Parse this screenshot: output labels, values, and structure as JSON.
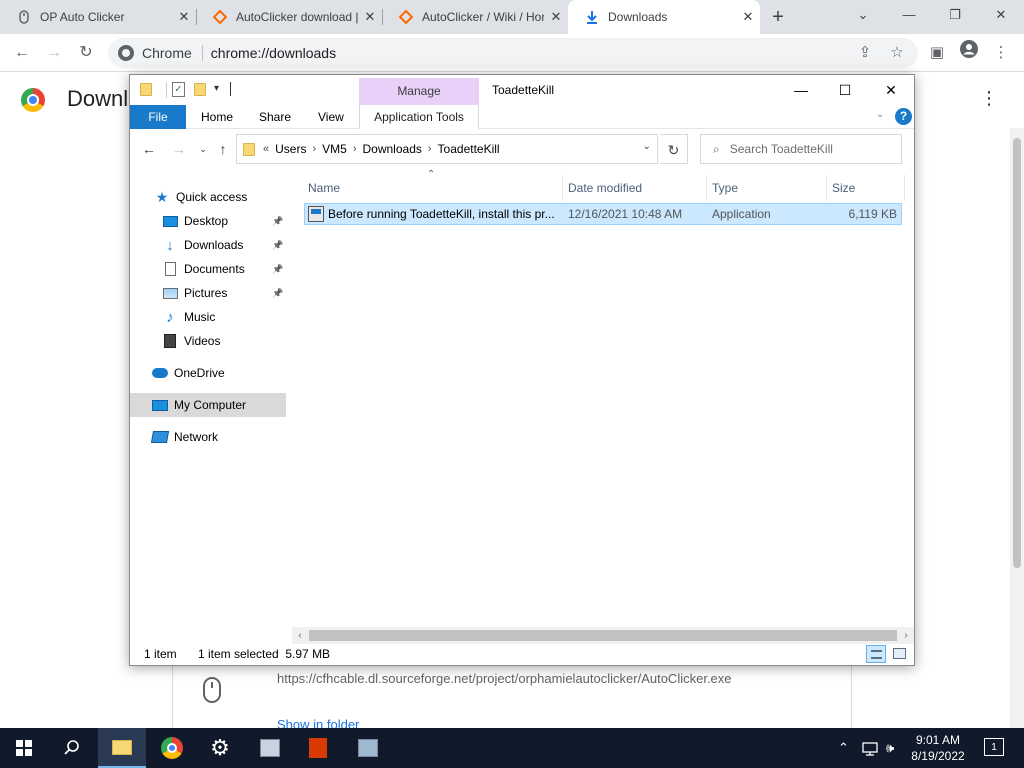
{
  "chrome": {
    "tabs": [
      {
        "title": "OP Auto Clicker",
        "favicon": "mouse-icon"
      },
      {
        "title": "AutoClicker download | SourceForge.net",
        "favicon": "sourceforge-icon"
      },
      {
        "title": "AutoClicker / Wiki / Home",
        "favicon": "sourceforge-icon"
      },
      {
        "title": "Downloads",
        "favicon": "download-icon"
      }
    ],
    "omnibox": {
      "chip": "Chrome",
      "url": "chrome://downloads"
    }
  },
  "downloads_page": {
    "title": "Downloads",
    "item": {
      "url": "https://cfhcable.dl.sourceforge.net/project/orphamielautoclicker/AutoClicker.exe",
      "show_in_folder": "Show in folder"
    }
  },
  "explorer": {
    "title": "ToadetteKill",
    "manage_label": "Manage",
    "ribbon_tabs": [
      "File",
      "Home",
      "Share",
      "View",
      "Application Tools"
    ],
    "breadcrumb": {
      "prefix": "«",
      "parts": [
        "Users",
        "VM5",
        "Downloads",
        "ToadetteKill"
      ]
    },
    "search_placeholder": "Search ToadetteKill",
    "nav": [
      {
        "label": "Quick access",
        "icon": "star-icon",
        "pinned": false
      },
      {
        "label": "Desktop",
        "icon": "desktop-icon",
        "pinned": true
      },
      {
        "label": "Downloads",
        "icon": "download-arrow-icon",
        "pinned": true
      },
      {
        "label": "Documents",
        "icon": "document-icon",
        "pinned": true
      },
      {
        "label": "Pictures",
        "icon": "pictures-icon",
        "pinned": true
      },
      {
        "label": "Music",
        "icon": "music-icon",
        "pinned": false
      },
      {
        "label": "Videos",
        "icon": "videos-icon",
        "pinned": false
      },
      {
        "label": "OneDrive",
        "icon": "onedrive-icon",
        "pinned": false
      },
      {
        "label": "My Computer",
        "icon": "computer-icon",
        "pinned": false,
        "selected": true
      },
      {
        "label": "Network",
        "icon": "network-icon",
        "pinned": false
      }
    ],
    "columns": [
      "Name",
      "Date modified",
      "Type",
      "Size"
    ],
    "files": [
      {
        "name": "Before running ToadetteKill, install this pr...",
        "date": "12/16/2021 10:48 AM",
        "type": "Application",
        "size": "6,119 KB",
        "selected": true
      }
    ],
    "status": {
      "count": "1 item",
      "selection": "1 item selected  5.97 MB"
    }
  },
  "taskbar": {
    "time": "9:01 AM",
    "date": "8/19/2022",
    "notifications": "1",
    "accent": "#76b9ed"
  }
}
